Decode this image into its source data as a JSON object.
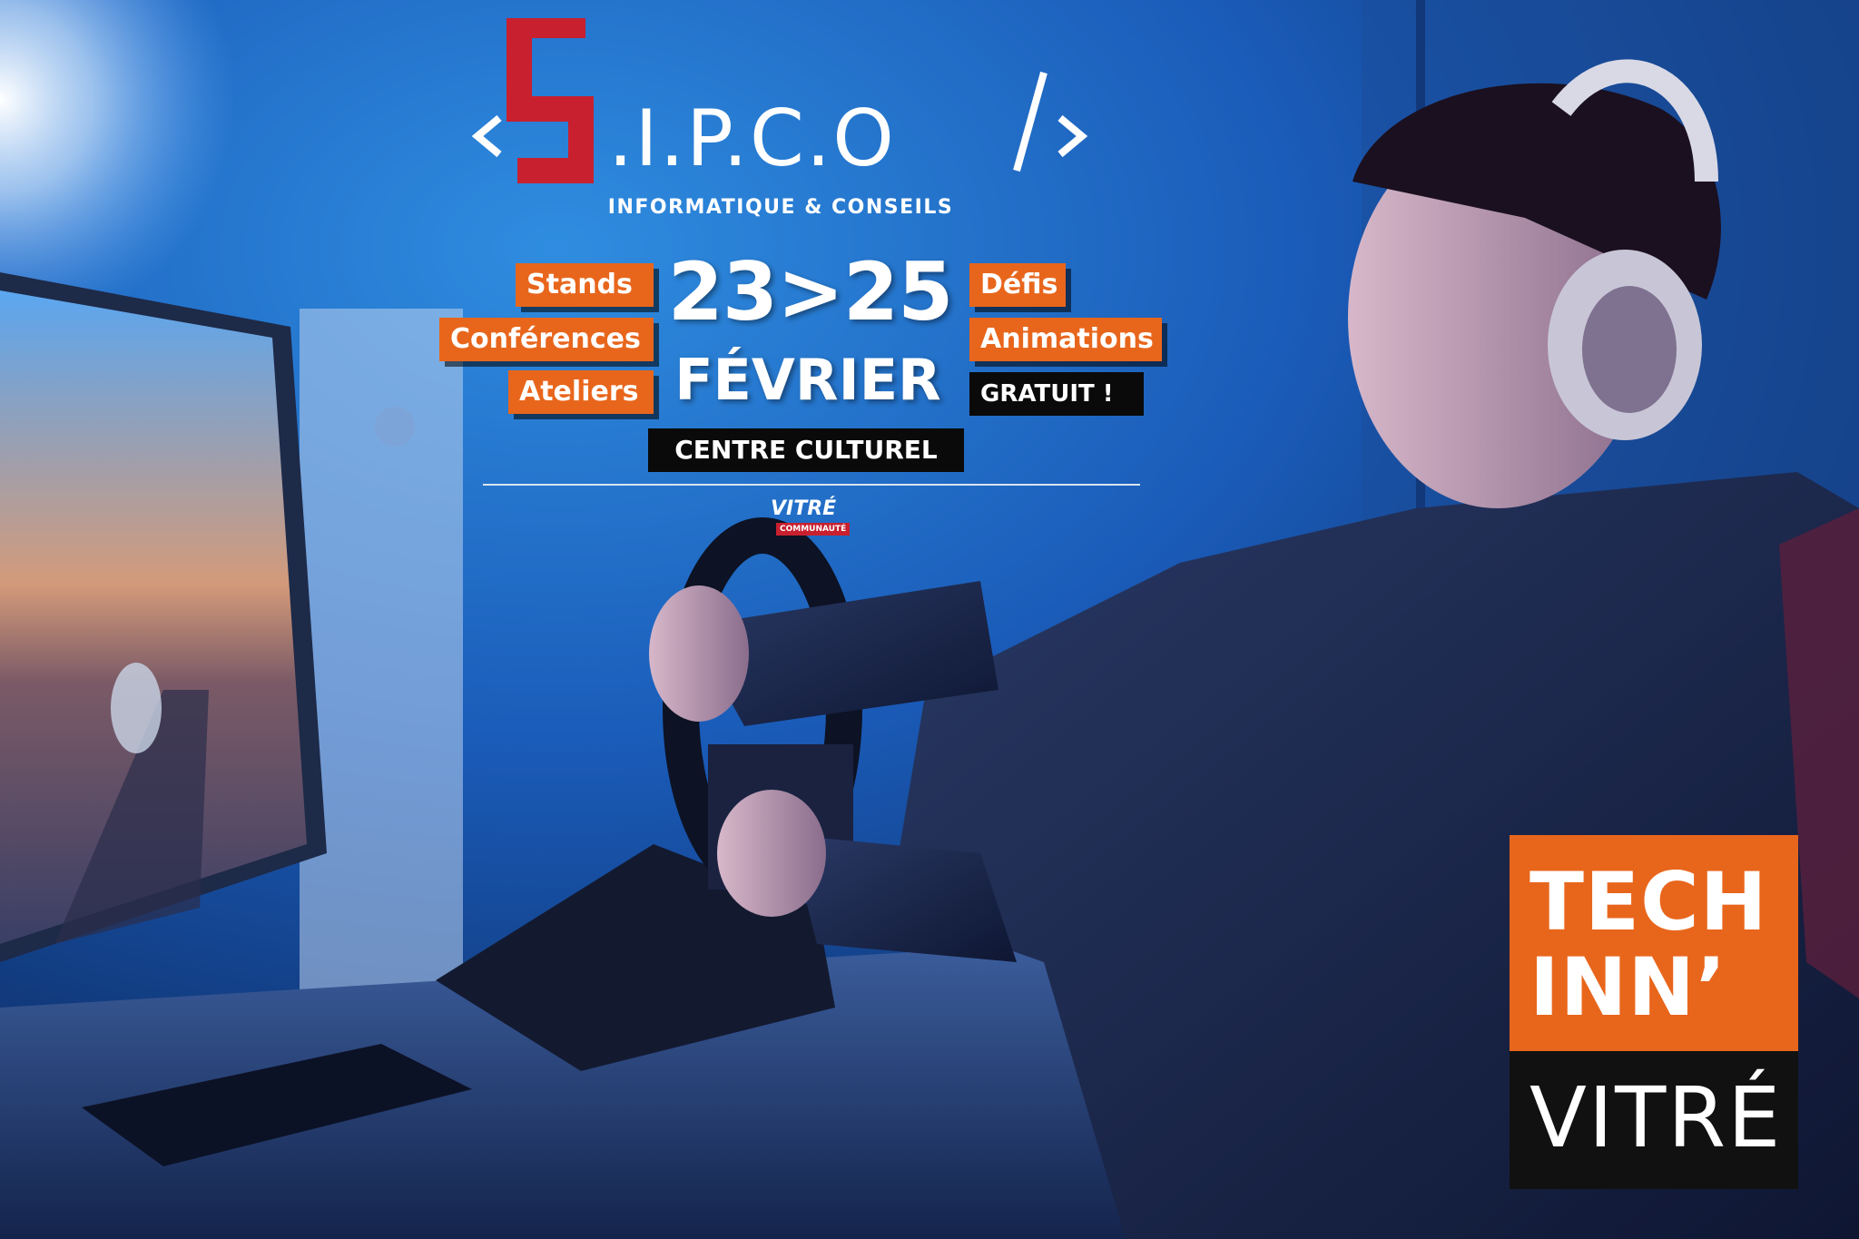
{
  "brand": {
    "logo_text": "S.I.P.C.O",
    "tagline": "INFORMATIQUE & CONSEILS",
    "accent_color": "#c8202f"
  },
  "event": {
    "left_tags": [
      "Stands",
      "Conférences",
      "Ateliers"
    ],
    "right_tags": [
      "Défis",
      "Animations"
    ],
    "free_label": "GRATUIT !",
    "date_range": "23>25",
    "month": "FÉVRIER",
    "venue": "CENTRE CULTUREL",
    "tag_color": "#e8661c"
  },
  "partner_logo": {
    "name": "VITRÉ",
    "sub": "COMMUNAUTÉ"
  },
  "badge": {
    "line1": "TECH",
    "line2": "INN’",
    "line3": "VITRÉ"
  }
}
